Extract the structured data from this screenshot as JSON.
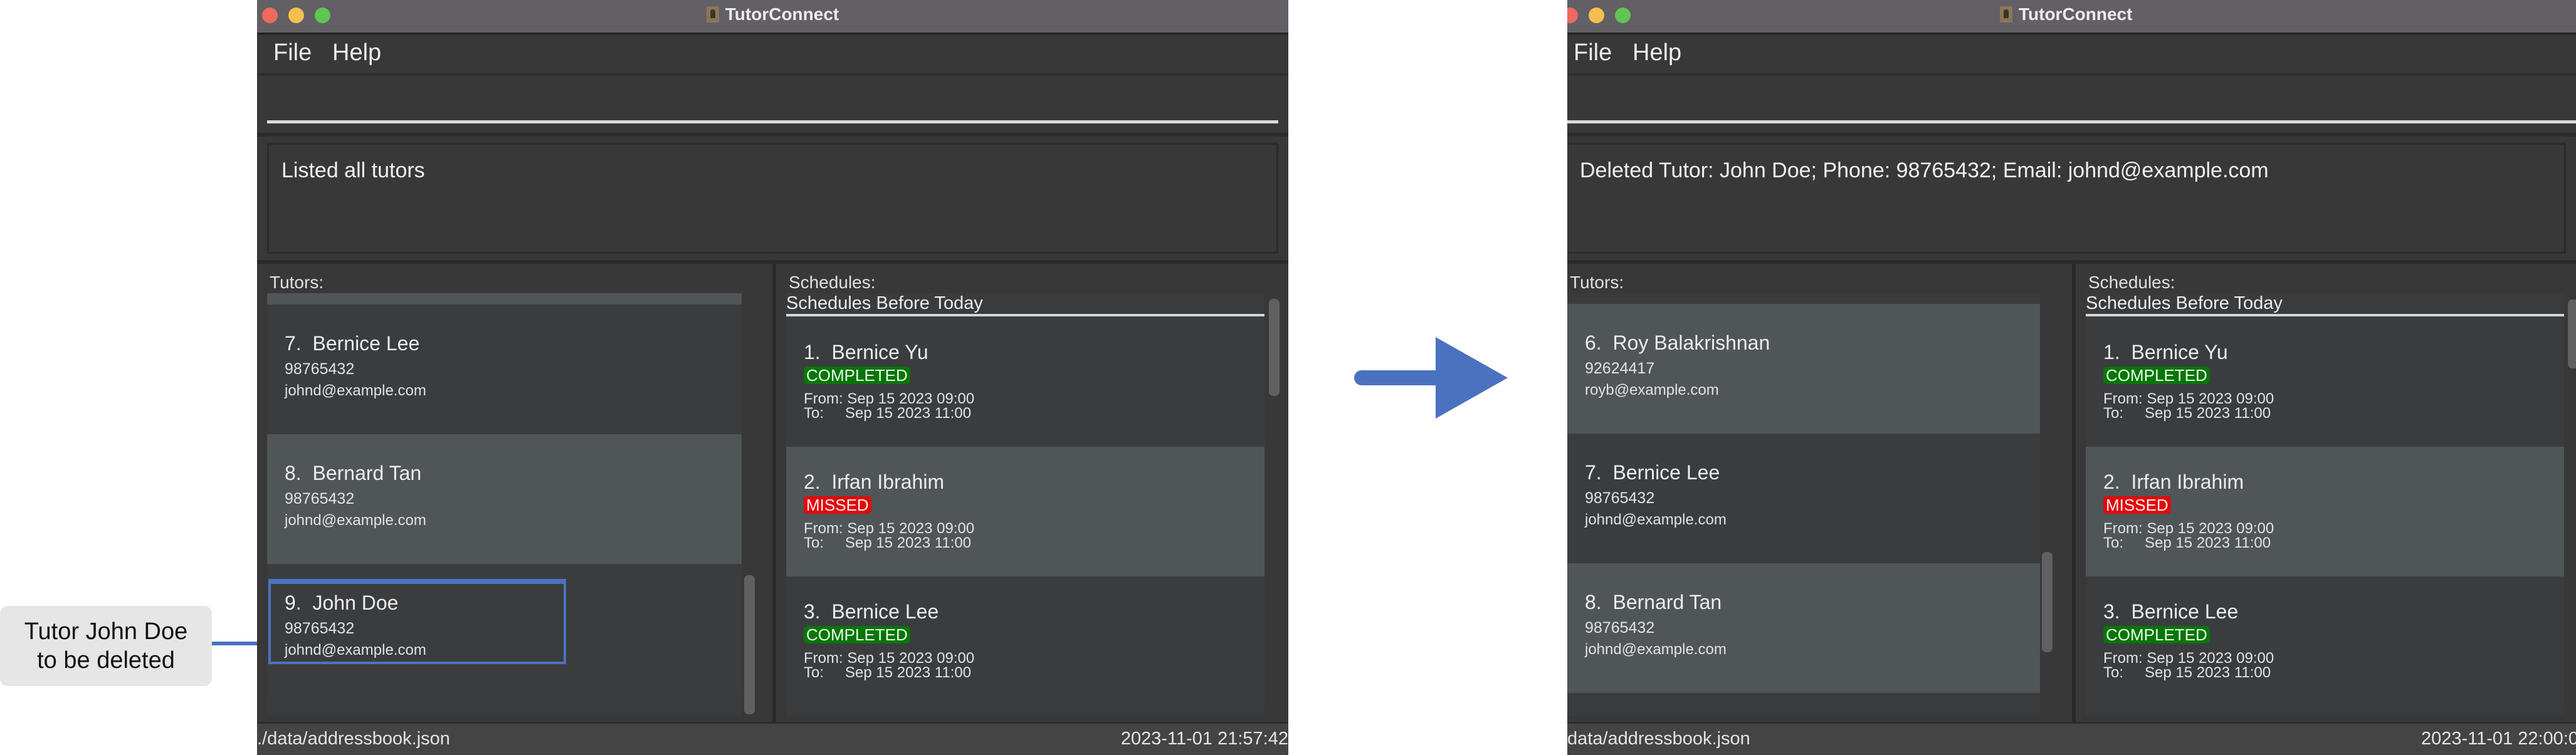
{
  "app": {
    "title": "TutorConnect",
    "menu": [
      "File",
      "Help"
    ]
  },
  "annotation": {
    "line1": "Tutor John Doe",
    "line2": "to be deleted"
  },
  "colors": {
    "accent": "#4b72bf",
    "completed": "#087508",
    "missed": "#e00a0a",
    "window_bg": "#383838"
  },
  "before": {
    "command_input": "",
    "result": "Listed all tutors",
    "tutors_label": "Tutors:",
    "tutors": [
      {
        "index": "7.",
        "name": "Bernice Lee",
        "phone": "98765432",
        "email": "johnd@example.com"
      },
      {
        "index": "8.",
        "name": "Bernard Tan",
        "phone": "98765432",
        "email": "johnd@example.com"
      },
      {
        "index": "9.",
        "name": "John Doe",
        "phone": "98765432",
        "email": "johnd@example.com"
      }
    ],
    "schedules_label": "Schedules:",
    "schedules_section": "Schedules Before Today",
    "schedules": [
      {
        "index": "1.",
        "name": "Bernice Yu",
        "status": "COMPLETED",
        "from_label": "From:",
        "from": "Sep 15 2023 09:00",
        "to_label": "To:",
        "to": "Sep 15 2023 11:00"
      },
      {
        "index": "2.",
        "name": "Irfan Ibrahim",
        "status": "MISSED",
        "from_label": "From:",
        "from": "Sep 15 2023 09:00",
        "to_label": "To:",
        "to": "Sep 15 2023 11:00"
      },
      {
        "index": "3.",
        "name": "Bernice Lee",
        "status": "COMPLETED",
        "from_label": "From:",
        "from": "Sep 15 2023 09:00",
        "to_label": "To:",
        "to": "Sep 15 2023 11:00"
      }
    ],
    "status_path": "./data/addressbook.json",
    "status_time": "2023-11-01 21:57:42"
  },
  "after": {
    "command_input": "",
    "result": "Deleted Tutor: John Doe; Phone: 98765432; Email: johnd@example.com",
    "tutors_label": "Tutors:",
    "tutors": [
      {
        "index": "6.",
        "name": "Roy Balakrishnan",
        "phone": "92624417",
        "email": "royb@example.com"
      },
      {
        "index": "7.",
        "name": "Bernice Lee",
        "phone": "98765432",
        "email": "johnd@example.com"
      },
      {
        "index": "8.",
        "name": "Bernard Tan",
        "phone": "98765432",
        "email": "johnd@example.com"
      }
    ],
    "schedules_label": "Schedules:",
    "schedules_section": "Schedules Before Today",
    "schedules": [
      {
        "index": "1.",
        "name": "Bernice Yu",
        "status": "COMPLETED",
        "from_label": "From:",
        "from": "Sep 15 2023 09:00",
        "to_label": "To:",
        "to": "Sep 15 2023 11:00"
      },
      {
        "index": "2.",
        "name": "Irfan Ibrahim",
        "status": "MISSED",
        "from_label": "From:",
        "from": "Sep 15 2023 09:00",
        "to_label": "To:",
        "to": "Sep 15 2023 11:00"
      },
      {
        "index": "3.",
        "name": "Bernice Lee",
        "status": "COMPLETED",
        "from_label": "From:",
        "from": "Sep 15 2023 09:00",
        "to_label": "To:",
        "to": "Sep 15 2023 11:00"
      }
    ],
    "status_path": "data/addressbook.json",
    "status_time": "2023-11-01 22:00:0"
  }
}
